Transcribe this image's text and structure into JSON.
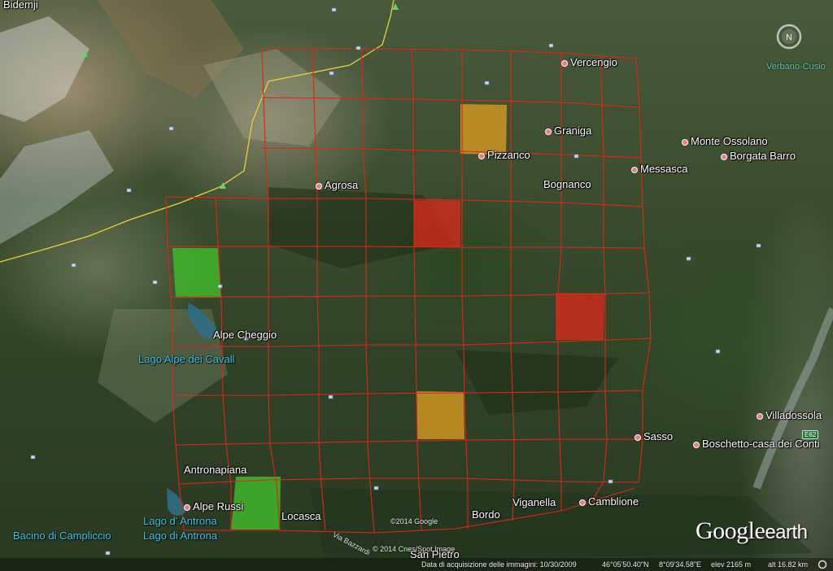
{
  "places": {
    "bidemji": "Bidemji",
    "vercengio": "Vercengio",
    "graniga": "Graniga",
    "pizzanco": "Pizzanco",
    "monte_ossolano": "Monte Ossolano",
    "borgata_barro": "Borgata Barro",
    "messasca": "Messasca",
    "bognanco": "Bognanco",
    "agrosa": "Agrosa",
    "alpe_cheggio": "Alpe Cheggio",
    "antronapiana": "Antronapiana",
    "alpe_russi": "Alpe Russi",
    "locasca": "Locasca",
    "bordo": "Bordo",
    "viganella": "Viganella",
    "camblione": "Camblione",
    "sasso": "Sasso",
    "boschetto": "Boschetto-casa dei Conti",
    "villadossola": "Villadossola",
    "san_pietro": "San Pietro"
  },
  "water": {
    "lago_alpe_dei_cavalli": "Lago Alpe dei Cavall",
    "lago_d_antrona": "Lago d' Antrona",
    "lago_di_antrona": "Lago di Antrona",
    "bacino_di_campliccio": "Bacino di Campliccio"
  },
  "region": "Verbano-Cusio",
  "road": "Via Bazzardi",
  "highway_badge": "E62",
  "copyright_google": "©2014 Google",
  "copyright_image": "© 2014 Cnes/Spot Image",
  "logo_google": "Google",
  "logo_earth": "earth",
  "status": {
    "date": "Data di acquisizione delle immagini: 10/30/2009",
    "lat": "46°05'50.40\"N",
    "lon": "8°09'34.58\"E",
    "elev": "elev  2165 m",
    "alt": "alt  16.82 km"
  },
  "colors": {
    "grid_line": "#e0241c",
    "cell_red": "#d42a1a",
    "cell_orange": "#d79a22",
    "cell_green": "#3fb62a",
    "border_line": "#e8d23a"
  },
  "grid": {
    "rows": 9,
    "columns": 10,
    "highlighted_cells": [
      {
        "row": 1,
        "col": 4,
        "status": "orange"
      },
      {
        "row": 3,
        "col": 3,
        "status": "red"
      },
      {
        "row": 4,
        "col": 0,
        "status": "green"
      },
      {
        "row": 5,
        "col": 6,
        "status": "red"
      },
      {
        "row": 7,
        "col": 4,
        "status": "orange"
      },
      {
        "row": 9,
        "col": 1,
        "status": "green"
      }
    ]
  },
  "icons": [
    "compass-icon",
    "photo-marker-icon",
    "place-dot-icon",
    "peak-icon"
  ]
}
